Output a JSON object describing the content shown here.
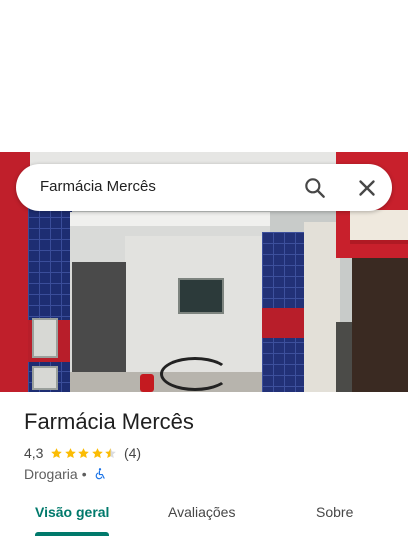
{
  "search": {
    "query": "Farmácia Mercês",
    "search_icon": "search-icon",
    "close_icon": "close-icon"
  },
  "place": {
    "name": "Farmácia Mercês",
    "rating": "4,3",
    "rating_value": 4.3,
    "review_count": "(4)",
    "category": "Drogaria",
    "separator": "•",
    "accessibility_icon": "wheelchair-icon"
  },
  "tabs": [
    {
      "label": "Visão geral",
      "active": true
    },
    {
      "label": "Avaliações",
      "active": false
    },
    {
      "label": "Sobre",
      "active": false
    }
  ],
  "colors": {
    "accent": "#00796b",
    "star": "#fbbc04",
    "accessibility": "#1a73e8"
  }
}
